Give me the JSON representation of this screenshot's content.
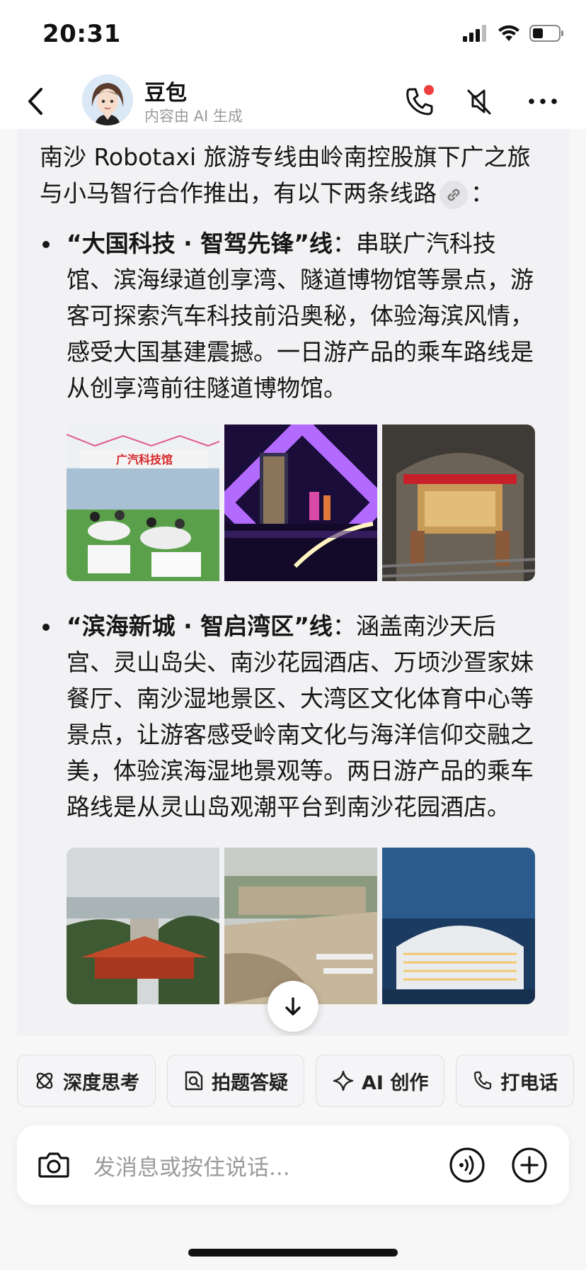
{
  "status_bar": {
    "time": "20:31"
  },
  "header": {
    "bot_name": "豆包",
    "subtitle": "内容由 AI 生成"
  },
  "message": {
    "intro": "南沙 Robotaxi 旅游专线由岭南控股旗下广之旅与小马智行合作推出，有以下两条线路",
    "intro_end": "：",
    "routes": [
      {
        "title": "“大国科技 · 智驾先锋”线",
        "desc": "：串联广汽科技馆、滨海绿道创享湾、隧道博物馆等景点，游客可探索汽车科技前沿奥秘，体验海滨风情，感受大国基建震撼。一日游产品的乘车路线是从创享湾前往隧道博物馆。",
        "images": [
          {
            "caption": "广汽科技馆"
          },
          {
            "caption": ""
          },
          {
            "caption": ""
          }
        ]
      },
      {
        "title": "“滨海新城 · 智启湾区”线",
        "desc": "：涵盖南沙天后宫、灵山岛尖、南沙花园酒店、万顷沙疍家妹餐厅、南沙湿地景区、大湾区文化体育中心等景点，让游客感受岭南文化与海洋信仰交融之美，体验滨海湿地景观等。两日游产品的乘车路线是从灵山岛观潮平台到南沙花园酒店。",
        "images": [
          {
            "caption": ""
          },
          {
            "caption": ""
          },
          {
            "caption": ""
          }
        ]
      }
    ]
  },
  "chips": [
    {
      "label": "深度思考",
      "icon": "deep-think-icon"
    },
    {
      "label": "拍题答疑",
      "icon": "photo-question-icon"
    },
    {
      "label": "AI 创作",
      "icon": "sparkle-icon"
    },
    {
      "label": "打电话",
      "icon": "phone-icon"
    }
  ],
  "input": {
    "placeholder": "发消息或按住说话..."
  }
}
